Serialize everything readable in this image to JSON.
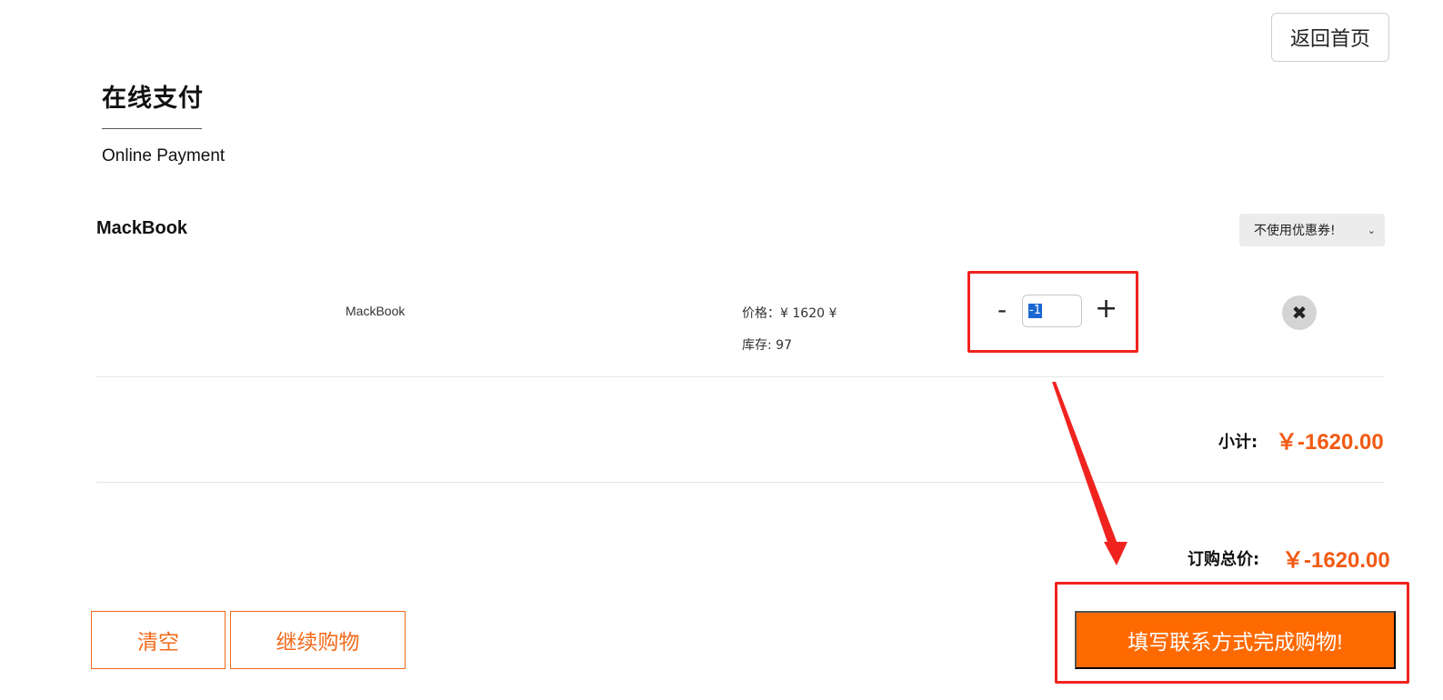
{
  "header": {
    "home_button": "返回首页",
    "title": "在线支付",
    "subtitle": "Online Payment"
  },
  "cart": {
    "product_heading": "MackBook",
    "coupon_select": {
      "selected": "不使用优惠券!"
    },
    "item": {
      "name": "MackBook",
      "price_label": "价格：¥",
      "price_value": "1620",
      "price_currency_suffix": "¥",
      "stock_label": "库存:",
      "stock_value": "97",
      "quantity": "-1",
      "minus_label": "-",
      "plus_label": "+"
    },
    "subtotal": {
      "label": "小计:",
      "value": "￥-1620.00"
    },
    "total": {
      "label": "订购总价:",
      "value": "￥-1620.00"
    }
  },
  "actions": {
    "clear_label": "清空",
    "continue_label": "继续购物",
    "checkout_label": "填写联系方式完成购物!"
  },
  "colors": {
    "accent": "#ff6a00",
    "price_text": "#f25a14",
    "annotation_red": "#f0231f"
  }
}
